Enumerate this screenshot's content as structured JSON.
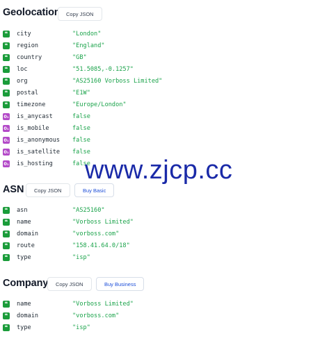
{
  "geolocation": {
    "title": "Geolocation",
    "copy_label": "Copy JSON",
    "fields": [
      {
        "key": "city",
        "value": "\"London\"",
        "type": "string"
      },
      {
        "key": "region",
        "value": "\"England\"",
        "type": "string"
      },
      {
        "key": "country",
        "value": "\"GB\"",
        "type": "string"
      },
      {
        "key": "loc",
        "value": "\"51.5085,-0.1257\"",
        "type": "string"
      },
      {
        "key": "org",
        "value": "\"AS25160 Vorboss Limited\"",
        "type": "string"
      },
      {
        "key": "postal",
        "value": "\"E1W\"",
        "type": "string"
      },
      {
        "key": "timezone",
        "value": "\"Europe/London\"",
        "type": "string"
      },
      {
        "key": "is_anycast",
        "value": "false",
        "type": "boolean"
      },
      {
        "key": "is_mobile",
        "value": "false",
        "type": "boolean"
      },
      {
        "key": "is_anonymous",
        "value": "false",
        "type": "boolean"
      },
      {
        "key": "is_satellite",
        "value": "false",
        "type": "boolean"
      },
      {
        "key": "is_hosting",
        "value": "false",
        "type": "boolean"
      }
    ]
  },
  "asn": {
    "title": "ASN",
    "copy_label": "Copy JSON",
    "buy_label": "Buy Basic",
    "fields": [
      {
        "key": "asn",
        "value": "\"AS25160\"",
        "type": "string"
      },
      {
        "key": "name",
        "value": "\"Vorboss Limited\"",
        "type": "string"
      },
      {
        "key": "domain",
        "value": "\"vorboss.com\"",
        "type": "string"
      },
      {
        "key": "route",
        "value": "\"158.41.64.0/18\"",
        "type": "string"
      },
      {
        "key": "type",
        "value": "\"isp\"",
        "type": "string"
      }
    ]
  },
  "company": {
    "title": "Company",
    "copy_label": "Copy JSON",
    "buy_label": "Buy Business",
    "fields": [
      {
        "key": "name",
        "value": "\"Vorboss Limited\"",
        "type": "string"
      },
      {
        "key": "domain",
        "value": "\"vorboss.com\"",
        "type": "string"
      },
      {
        "key": "type",
        "value": "\"isp\"",
        "type": "string"
      }
    ]
  },
  "icons": {
    "string_icon": "quote-icon",
    "boolean_icon": "toggle-icon",
    "string_glyph": "❝",
    "boolean_glyph": "0₁"
  },
  "colors": {
    "string_icon_bg": "#1a9c3a",
    "boolean_icon_bg": "#b34ac8",
    "value_text": "#1aa34a",
    "buy_text": "#1d4ed8",
    "watermark": "#1a2aa8"
  },
  "watermark": {
    "text": "www.zjcp.cc"
  }
}
